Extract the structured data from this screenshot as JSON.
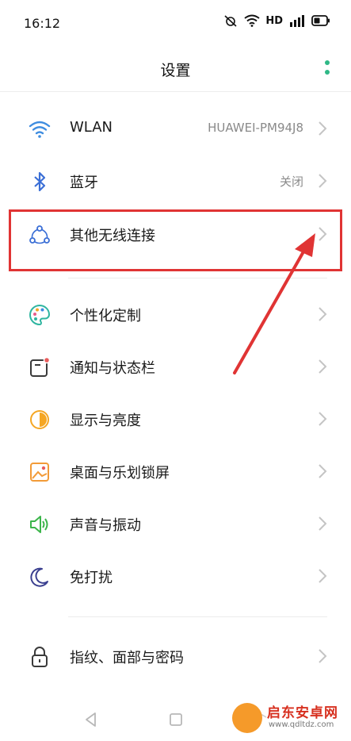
{
  "status_bar": {
    "time": "16:12",
    "hd_label": "HD",
    "icons": [
      "alarm-muted-icon",
      "wifi-icon",
      "hd-icon",
      "signal-4g-icon",
      "battery-icon"
    ]
  },
  "header": {
    "title": "设置",
    "menu_icon": "more-vertical-icon"
  },
  "settings": [
    {
      "id": "wlan",
      "label": "WLAN",
      "value": "HUAWEI-PM94J8",
      "icon": "wifi-icon"
    },
    {
      "id": "bluetooth",
      "label": "蓝牙",
      "value": "关闭",
      "icon": "bluetooth-icon"
    },
    {
      "id": "other-wireless",
      "label": "其他无线连接",
      "value": "",
      "icon": "connection-icon"
    },
    {
      "id": "personalize",
      "label": "个性化定制",
      "value": "",
      "icon": "palette-icon"
    },
    {
      "id": "notification",
      "label": "通知与状态栏",
      "value": "",
      "icon": "notification-icon"
    },
    {
      "id": "display",
      "label": "显示与亮度",
      "value": "",
      "icon": "brightness-icon"
    },
    {
      "id": "wallpaper",
      "label": "桌面与乐划锁屏",
      "value": "",
      "icon": "wallpaper-icon"
    },
    {
      "id": "sound",
      "label": "声音与振动",
      "value": "",
      "icon": "speaker-icon"
    },
    {
      "id": "dnd",
      "label": "免打扰",
      "value": "",
      "icon": "moon-icon"
    },
    {
      "id": "security",
      "label": "指纹、面部与密码",
      "value": "",
      "icon": "lock-icon"
    }
  ],
  "colors": {
    "accent": "#2fb886",
    "highlight": "#e03434",
    "wifi": "#3f8de0",
    "bluetooth": "#3b6fd6"
  },
  "watermark": {
    "title": "启东安卓网",
    "url": "www.qdltdz.com"
  }
}
